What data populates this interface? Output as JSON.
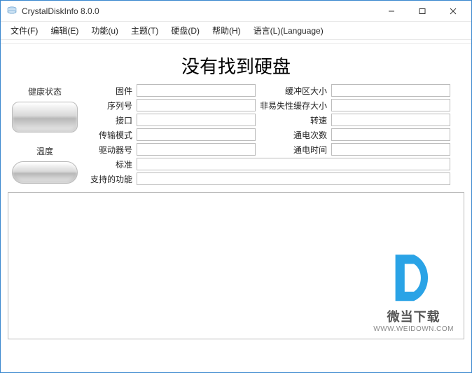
{
  "window": {
    "title": "CrystalDiskInfo 8.0.0"
  },
  "menu": {
    "file": "文件(F)",
    "edit": "编辑(E)",
    "func": "功能(u)",
    "theme": "主题(T)",
    "disk": "硬盘(D)",
    "help": "帮助(H)",
    "lang": "语言(L)(Language)"
  },
  "main": {
    "heading": "没有找到硬盘",
    "health_label": "健康状态",
    "temp_label": "温度"
  },
  "fields": {
    "firmware_label": "固件",
    "firmware_val": "",
    "serial_label": "序列号",
    "serial_val": "",
    "interface_label": "接口",
    "interface_val": "",
    "transfer_label": "传输模式",
    "transfer_val": "",
    "drive_label": "驱动器号",
    "drive_val": "",
    "standard_label": "标准",
    "standard_val": "",
    "supported_label": "支持的功能",
    "supported_val": "",
    "buffer_label": "缓冲区大小",
    "buffer_val": "",
    "nvcache_label": "非易失性缓存大小",
    "nvcache_val": "",
    "rpm_label": "转速",
    "rpm_val": "",
    "poweron_count_label": "通电次数",
    "poweron_count_val": "",
    "poweron_hours_label": "通电时间",
    "poweron_hours_val": ""
  },
  "watermark": {
    "name": "微当下载",
    "url": "WWW.WEIDOWN.COM"
  }
}
